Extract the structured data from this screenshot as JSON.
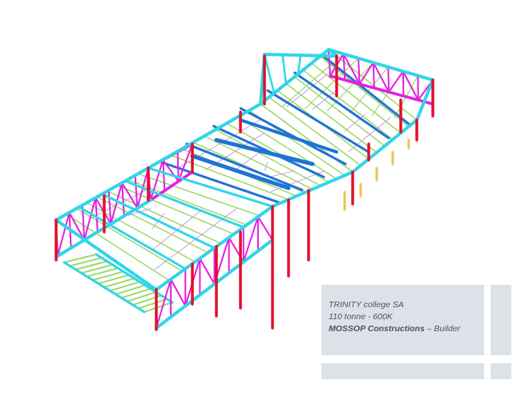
{
  "caption": {
    "line1": "TRINITY college SA",
    "line2": "110 tonne - 600K",
    "line3_strong": "MOSSOP Constructions",
    "line3_rest": " – Builder"
  },
  "colors": {
    "column": "#e0102a",
    "truss": "#e51ee0",
    "beam": "#2fd6e8",
    "beam_blue": "#1f73d6",
    "purlin": "#9ed86a",
    "brace": "#c89be6",
    "post_yellow": "#e8c84a",
    "panel": "#dde2e8",
    "caption_text": "#47536a"
  }
}
